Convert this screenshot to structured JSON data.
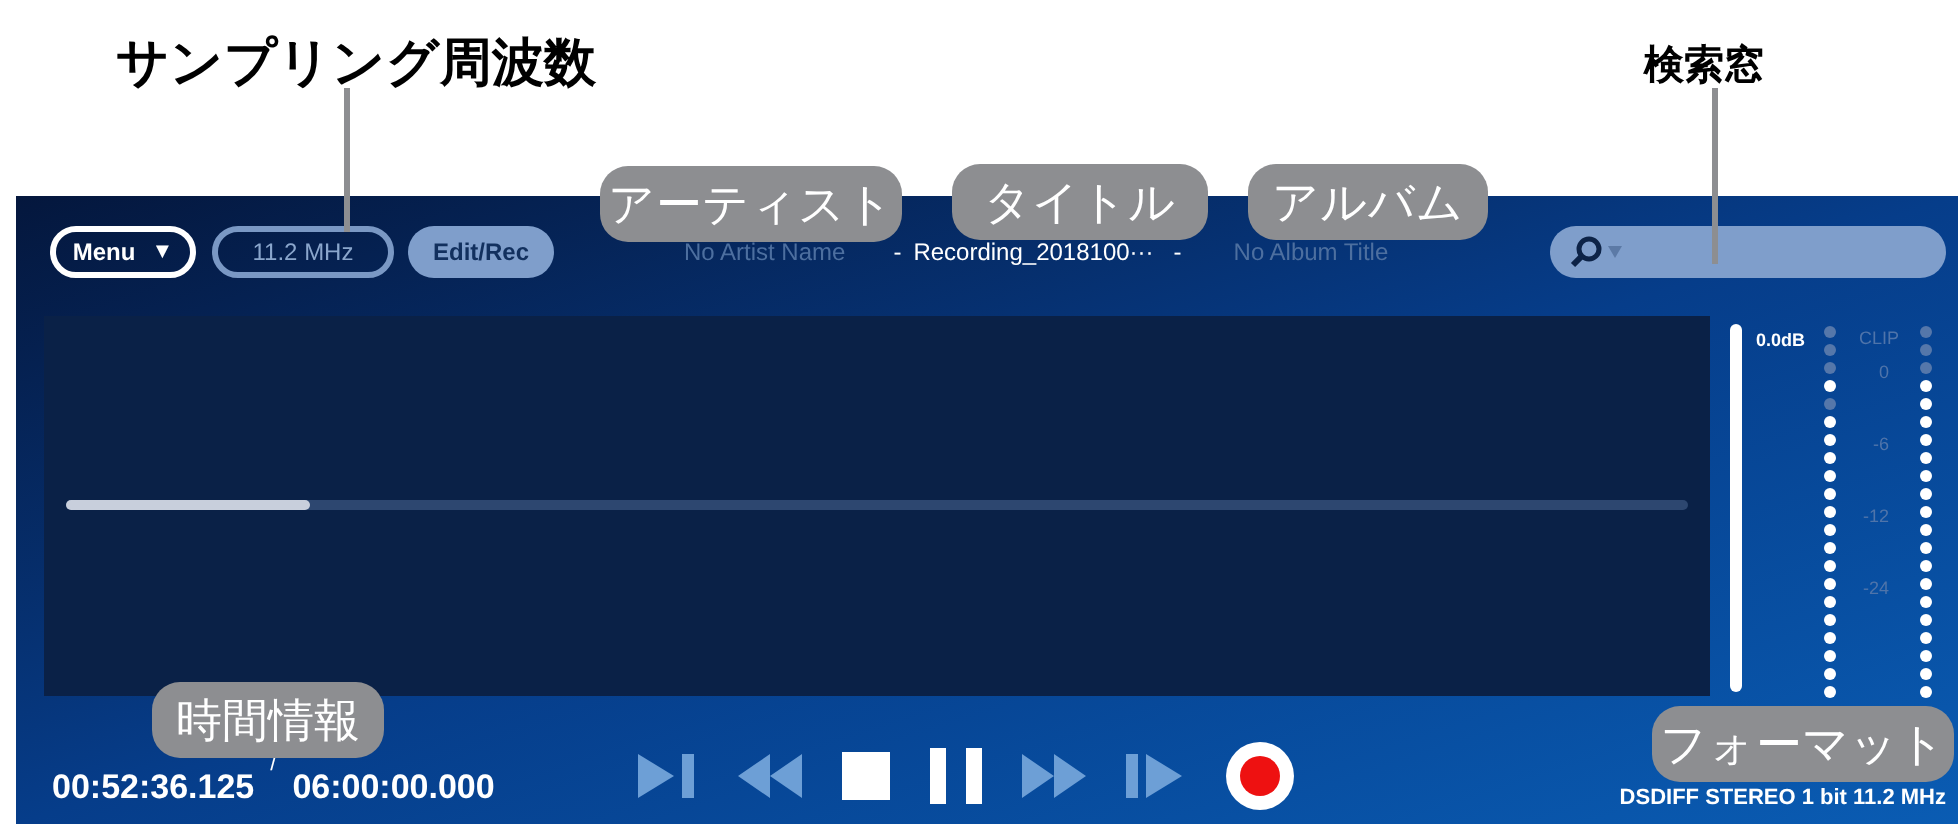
{
  "callouts": {
    "sampling": "サンプリング周波数",
    "search": "検索窓",
    "artist": "アーティスト",
    "title": "タイトル",
    "album": "アルバム",
    "time": "時間情報",
    "format": "フォーマット"
  },
  "top_bar": {
    "menu_button": "Menu",
    "menu_caret": "▼",
    "sample_rate": "11.2 MHz",
    "edit_button": "Edit/Rec",
    "artist": "No Artist Name",
    "title_marks": [
      "-",
      "-"
    ],
    "title": "Recording_2018100···",
    "album": "No Album Title"
  },
  "progress": {
    "level": 0.15
  },
  "meter": {
    "peak": "0.0dB",
    "clip": "CLIP",
    "scale": [
      "0",
      "-6",
      "-12",
      "-24"
    ]
  },
  "time": {
    "current": "00:52:36.125",
    "separator": "/",
    "total": "06:00:00.000"
  },
  "transport": [
    {
      "kind": "skip",
      "disabled": true
    },
    {
      "kind": "rewind",
      "disabled": true
    },
    {
      "kind": "stop",
      "disabled": false
    },
    {
      "kind": "pause",
      "disabled": false
    },
    {
      "kind": "forward",
      "disabled": true
    },
    {
      "kind": "step",
      "disabled": true
    },
    {
      "kind": "record",
      "disabled": false
    }
  ],
  "format": "DSDIFF STEREO 1 bit 11.2 MHz"
}
